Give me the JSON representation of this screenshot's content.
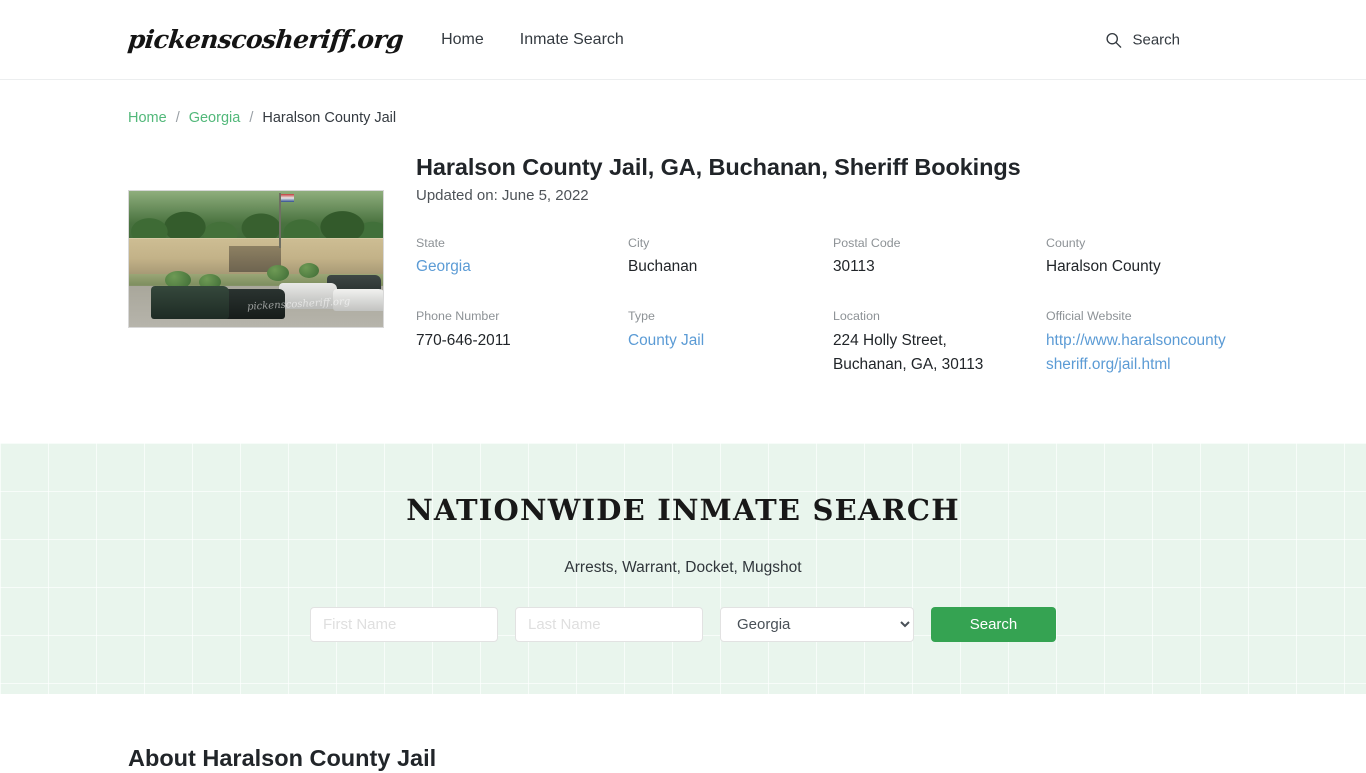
{
  "header": {
    "logo_text": "pickenscosheriff.org",
    "nav": [
      {
        "label": "Home"
      },
      {
        "label": "Inmate Search"
      }
    ],
    "search_label": "Search",
    "search_icon": "magnifier-icon"
  },
  "breadcrumb": {
    "items": [
      {
        "label": "Home",
        "link": true
      },
      {
        "label": "Georgia",
        "link": true
      },
      {
        "label": "Haralson County Jail",
        "link": false
      }
    ],
    "separator": "/"
  },
  "main": {
    "title": "Haralson County Jail, GA, Buchanan, Sheriff Bookings",
    "updated": "Updated on: June 5, 2022",
    "photo_watermark": "pickenscosheriff.org",
    "fields": [
      {
        "label": "State",
        "value": "Georgia",
        "link": true
      },
      {
        "label": "City",
        "value": "Buchanan",
        "link": false
      },
      {
        "label": "Postal Code",
        "value": "30113",
        "link": false
      },
      {
        "label": "County",
        "value": "Haralson County",
        "link": false
      },
      {
        "label": "Phone Number",
        "value": "770-646-2011",
        "link": false
      },
      {
        "label": "Type",
        "value": "County Jail",
        "link": true
      },
      {
        "label": "Location",
        "value": "224 Holly Street, Buchanan, GA, 30113",
        "link": false
      },
      {
        "label": "Official Website",
        "value": "http://www.haralsoncountysheriff.org/jail.html",
        "link": true
      }
    ]
  },
  "search_band": {
    "title": "NATIONWIDE INMATE SEARCH",
    "subtitle": "Arrests, Warrant, Docket, Mugshot",
    "first_name_placeholder": "First Name",
    "first_name_value": "",
    "last_name_placeholder": "Last Name",
    "last_name_value": "",
    "state_selected": "Georgia",
    "state_options": [
      "Georgia"
    ],
    "search_button": "Search"
  },
  "about": {
    "title": "About Haralson County Jail"
  },
  "colors": {
    "accent_green": "#35a352",
    "breadcrumb_link": "#52b87a",
    "value_link": "#5b9bd5",
    "band_bg": "#e9f5ed"
  }
}
